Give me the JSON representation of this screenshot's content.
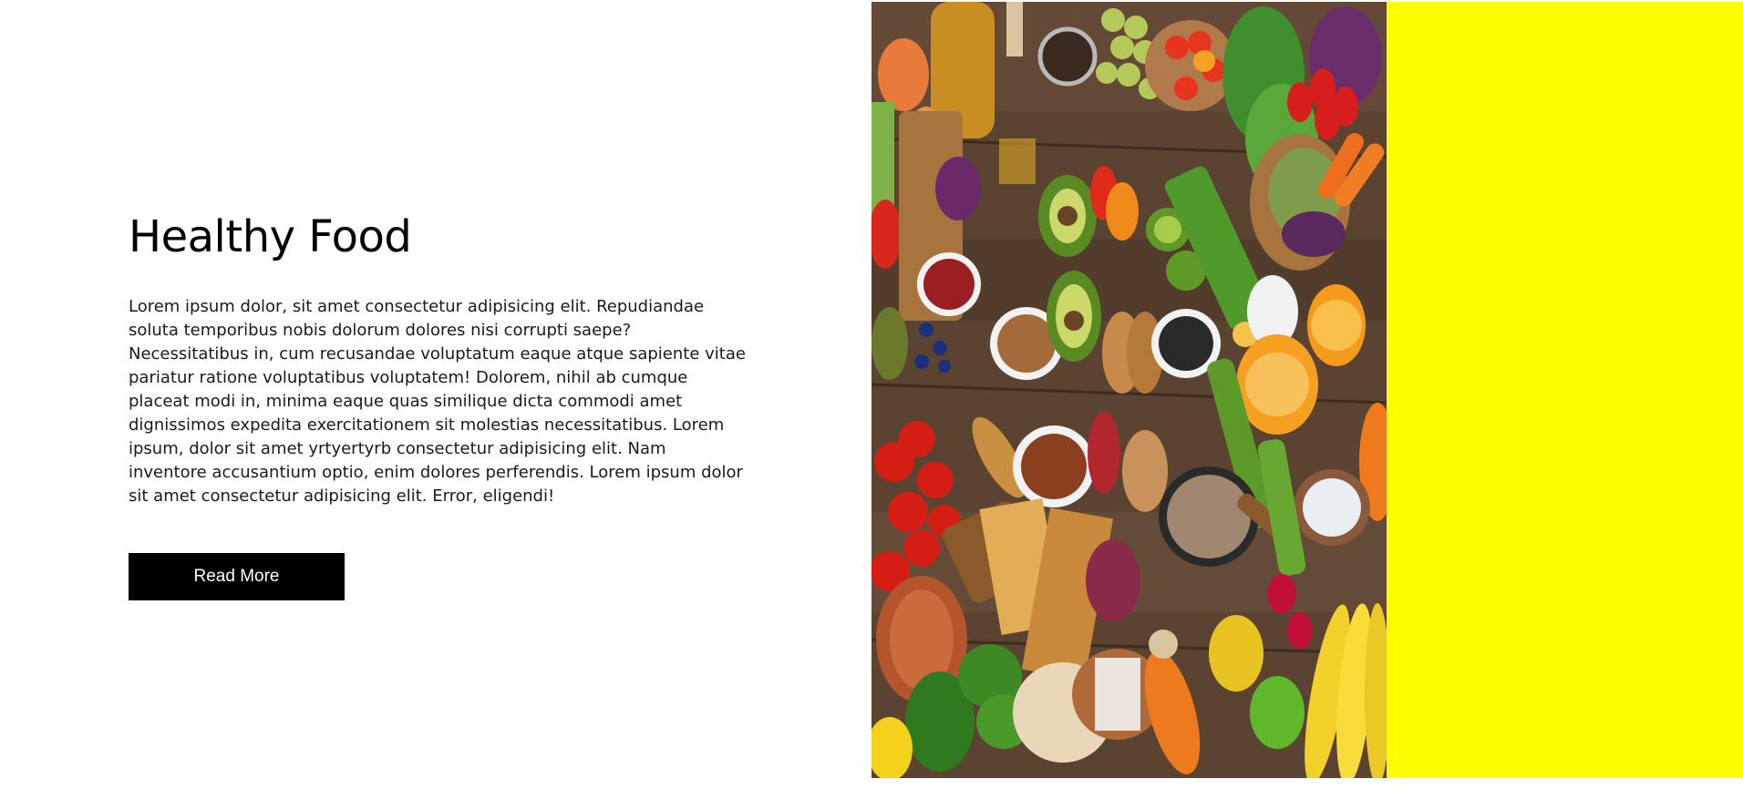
{
  "hero": {
    "title": "Healthy Food",
    "description": "Lorem ipsum dolor, sit amet consectetur adipisicing elit. Repudiandae soluta temporibus nobis dolorum dolores nisi corrupti saepe? Necessitatibus in, cum recusandae voluptatum eaque atque sapiente vitae pariatur ratione voluptatibus voluptatem! Dolorem, nihil ab cumque placeat modi in, minima eaque quas similique dicta commodi amet dignissimos expedita exercitationem sit molestias necessitatibus. Lorem ipsum, dolor sit amet yrtyertyrb consectetur adipisicing elit. Nam inventore accusantium optio, enim dolores perferendis. Lorem ipsum dolor sit amet consectetur adipisicing elit. Error, eligendi!",
    "button_label": "Read More"
  },
  "image": {
    "subject": "assorted-healthy-food-flatlay"
  },
  "colors": {
    "accent_panel": "#ffff00",
    "button_bg": "#000000",
    "button_text": "#ffffff",
    "page_bg": "#ffffff"
  }
}
